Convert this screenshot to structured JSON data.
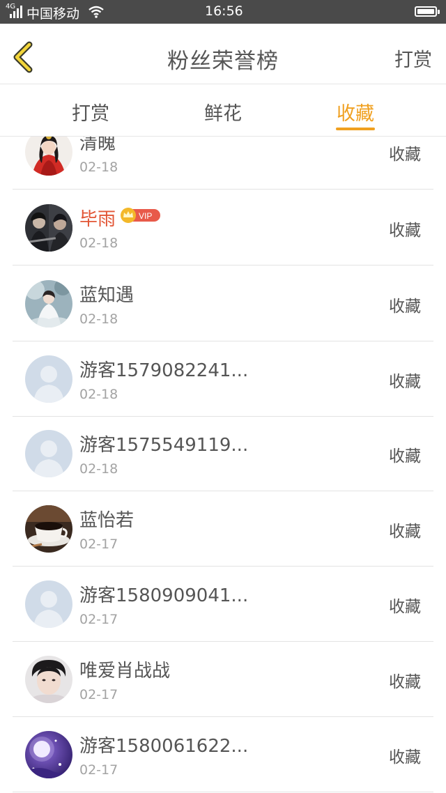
{
  "status_bar": {
    "network": "4G",
    "carrier": "中国移动",
    "time": "16:56"
  },
  "header": {
    "title": "粉丝荣誉榜",
    "action_label": "打赏"
  },
  "tabs": [
    {
      "label": "打赏",
      "active": false
    },
    {
      "label": "鲜花",
      "active": false
    },
    {
      "label": "收藏",
      "active": true
    }
  ],
  "colors": {
    "accent": "#f0a020",
    "vip_name": "#e25535",
    "text": "#555555",
    "muted": "#a3a3a3",
    "status_bar": "#4a4a4a"
  },
  "vip_badge": {
    "label": "VIP",
    "icon": "crown-icon"
  },
  "fans": [
    {
      "name": "清魄",
      "date": "02-18",
      "action": "收藏",
      "avatar": "red-costume-portrait-avatar",
      "vip": false
    },
    {
      "name": "毕雨",
      "date": "02-18",
      "action": "收藏",
      "avatar": "dark-portrait-avatar",
      "vip": true
    },
    {
      "name": "蓝知遇",
      "date": "02-18",
      "action": "收藏",
      "avatar": "white-figure-avatar",
      "vip": false
    },
    {
      "name": "游客1579082241...",
      "date": "02-18",
      "action": "收藏",
      "avatar": "default-user-avatar",
      "vip": false
    },
    {
      "name": "游客1575549119...",
      "date": "02-18",
      "action": "收藏",
      "avatar": "default-user-avatar",
      "vip": false
    },
    {
      "name": "蓝怡若",
      "date": "02-17",
      "action": "收藏",
      "avatar": "coffee-cup-avatar",
      "vip": false
    },
    {
      "name": "游客1580909041...",
      "date": "02-17",
      "action": "收藏",
      "avatar": "default-user-avatar",
      "vip": false
    },
    {
      "name": "唯爱肖战战",
      "date": "02-17",
      "action": "收藏",
      "avatar": "young-man-portrait-avatar",
      "vip": false
    },
    {
      "name": "游客1580061622...",
      "date": "02-17",
      "action": "收藏",
      "avatar": "purple-moon-avatar",
      "vip": false
    }
  ]
}
